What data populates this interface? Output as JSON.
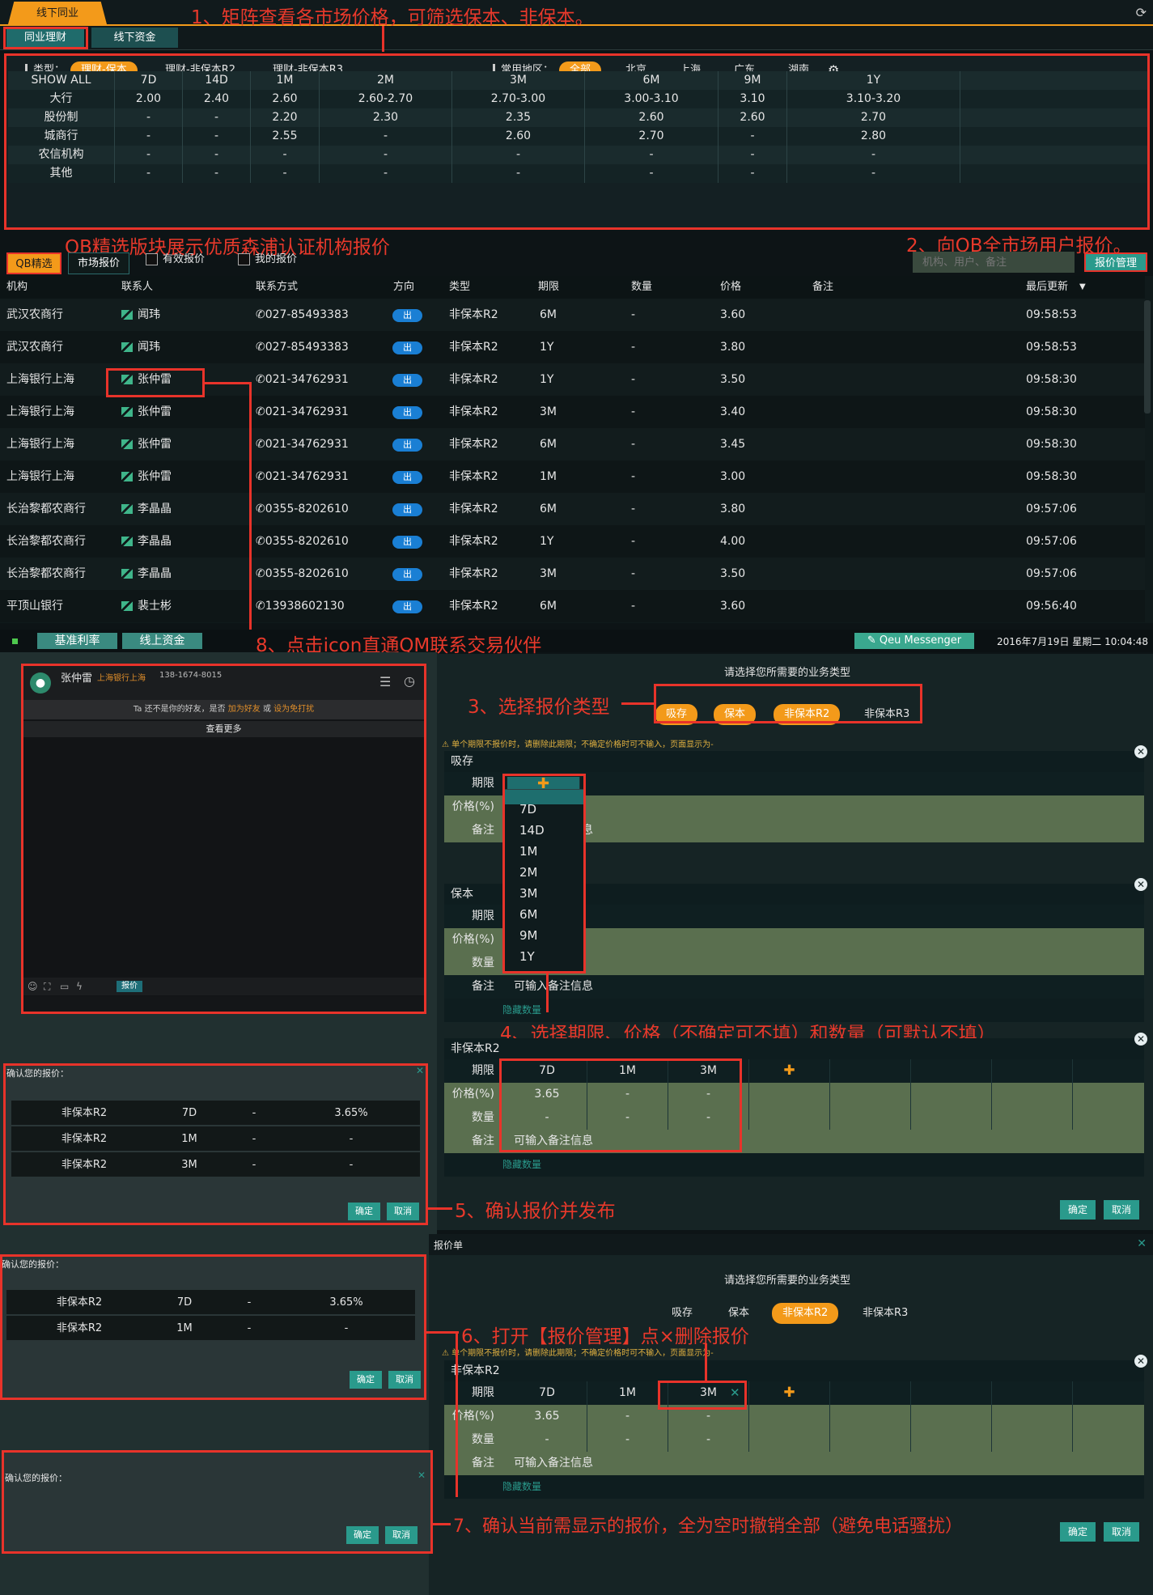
{
  "top": {
    "tab": "线下同业",
    "subtabs": [
      "同业理财",
      "线下资金"
    ]
  },
  "annotations": {
    "a1": "1、矩阵查看各市场价格，可筛选保本、非保本。",
    "a_qb": "QB精选版块展示优质森浦认证机构报价",
    "a2": "2、向QB全市场用户报价。",
    "a8": "8、点击icon直通QM联系交易伙伴",
    "a3": "3、选择报价类型",
    "a4": "4、选择期限、价格（不确定可不填）和数量（可默认不填）",
    "a5": "5、确认报价并发布",
    "a6": "6、打开【报价管理】点×删除报价",
    "a7": "7、确认当前需显示的报价，全为空时撤销全部（避免电话骚扰）"
  },
  "filters": {
    "type_label": "类型：",
    "types": [
      "理财-保本",
      "理财-非保本R2",
      "理财-非保本R3"
    ],
    "region_label": "常用地区：",
    "regions": [
      "全部",
      "北京",
      "上海",
      "广东",
      "湖南"
    ]
  },
  "matrix": {
    "headers": [
      "SHOW ALL",
      "7D",
      "14D",
      "1M",
      "2M",
      "3M",
      "6M",
      "9M",
      "1Y"
    ],
    "rows": [
      [
        "大行",
        "2.00",
        "2.40",
        "2.60",
        "2.60-2.70",
        "2.70-3.00",
        "3.00-3.10",
        "3.10",
        "3.10-3.20"
      ],
      [
        "股份制",
        "-",
        "-",
        "2.20",
        "2.30",
        "2.35",
        "2.60",
        "2.60",
        "2.70"
      ],
      [
        "城商行",
        "-",
        "-",
        "2.55",
        "-",
        "2.60",
        "2.70",
        "-",
        "2.80"
      ],
      [
        "农信机构",
        "-",
        "-",
        "-",
        "-",
        "-",
        "-",
        "-",
        "-"
      ],
      [
        "其他",
        "-",
        "-",
        "-",
        "-",
        "-",
        "-",
        "-",
        "-"
      ]
    ]
  },
  "listbar": {
    "qb_tab": "QB精选",
    "market_tab": "市场报价",
    "chk1": "有效报价",
    "chk2": "我的报价",
    "search_placeholder": "机构、用户、备注",
    "manage_btn": "报价管理"
  },
  "list": {
    "headers": [
      "机构",
      "联系人",
      "联系方式",
      "方向",
      "类型",
      "期限",
      "数量",
      "价格",
      "备注",
      "最后更新"
    ],
    "dir": "出",
    "rows": [
      [
        "武汉农商行",
        "闻玮",
        "027-85493383",
        "非保本R2",
        "6M",
        "-",
        "3.60",
        "09:58:53"
      ],
      [
        "武汉农商行",
        "闻玮",
        "027-85493383",
        "非保本R2",
        "1Y",
        "-",
        "3.80",
        "09:58:53"
      ],
      [
        "上海银行上海",
        "张仲雷",
        "021-34762931",
        "非保本R2",
        "1Y",
        "-",
        "3.50",
        "09:58:30"
      ],
      [
        "上海银行上海",
        "张仲雷",
        "021-34762931",
        "非保本R2",
        "3M",
        "-",
        "3.40",
        "09:58:30"
      ],
      [
        "上海银行上海",
        "张仲雷",
        "021-34762931",
        "非保本R2",
        "6M",
        "-",
        "3.45",
        "09:58:30"
      ],
      [
        "上海银行上海",
        "张仲雷",
        "021-34762931",
        "非保本R2",
        "1M",
        "-",
        "3.00",
        "09:58:30"
      ],
      [
        "长治黎都农商行",
        "李晶晶",
        "0355-8202610",
        "非保本R2",
        "6M",
        "-",
        "3.80",
        "09:57:06"
      ],
      [
        "长治黎都农商行",
        "李晶晶",
        "0355-8202610",
        "非保本R2",
        "1Y",
        "-",
        "4.00",
        "09:57:06"
      ],
      [
        "长治黎都农商行",
        "李晶晶",
        "0355-8202610",
        "非保本R2",
        "3M",
        "-",
        "3.50",
        "09:57:06"
      ],
      [
        "平顶山银行",
        "裴士彬",
        "13938602130",
        "非保本R2",
        "6M",
        "-",
        "3.60",
        "09:56:40"
      ]
    ]
  },
  "midbar": {
    "tabs": [
      "基准利率",
      "线上资金"
    ],
    "messenger": "Qeu Messenger",
    "datetime": "2016年7月19日 星期二 10:04:48"
  },
  "chat": {
    "name": "张仲雷",
    "org": "上海银行上海",
    "phone": "138-1674-8015",
    "notice_pre": "Ta 还不是你的好友，是否 ",
    "notice_link1": "加为好友",
    "notice_mid": " 或 ",
    "notice_link2": "设为免打扰",
    "more": "查看更多",
    "quote_btn": "报价"
  },
  "quote": {
    "prompt": "请选择您所需要的业务类型",
    "types": [
      "吸存",
      "保本",
      "非保本R2",
      "非保本R3"
    ],
    "warn": "单个期限不报价时，请删除此期限；不确定价格时可不输入，页面显示为-",
    "labels": {
      "term": "期限",
      "price": "价格(%)",
      "qty": "数量",
      "remark": "备注"
    },
    "remark_placeholder": "可输入备注信息",
    "remark_partial": "息",
    "hide_qty": "隐藏数量",
    "sections": [
      "吸存",
      "保本",
      "非保本R2"
    ],
    "r2_terms": [
      "7D",
      "1M",
      "3M"
    ],
    "r2_prices": [
      "3.65",
      "-",
      "-"
    ],
    "r2_qty": [
      "-",
      "-",
      "-"
    ],
    "ok": "确定",
    "cancel": "取消",
    "dropdown": [
      "7D",
      "14D",
      "1M",
      "2M",
      "3M",
      "6M",
      "9M",
      "1Y"
    ]
  },
  "confirm": {
    "title": "确认您的报价：",
    "rows1": [
      [
        "非保本R2",
        "7D",
        "-",
        "3.65%"
      ],
      [
        "非保本R2",
        "1M",
        "-",
        "-"
      ],
      [
        "非保本R2",
        "3M",
        "-",
        "-"
      ]
    ],
    "rows2": [
      [
        "非保本R2",
        "7D",
        "-",
        "3.65%"
      ],
      [
        "非保本R2",
        "1M",
        "-",
        "-"
      ]
    ],
    "ok": "确定",
    "cancel": "取消"
  },
  "quote2": {
    "title": "报价单",
    "terms": [
      "7D",
      "1M",
      "3M"
    ]
  }
}
